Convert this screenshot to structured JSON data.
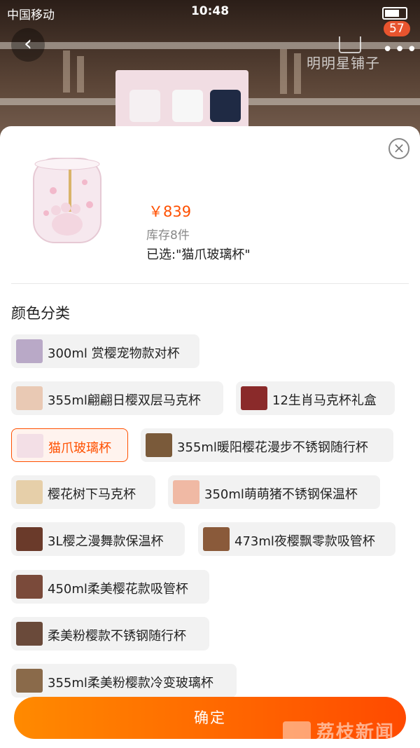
{
  "status_bar": {
    "carrier": "中国移动",
    "time": "10:48"
  },
  "header": {
    "shop_name": "明明星铺子",
    "cart_badge": "57"
  },
  "product": {
    "price": "￥839",
    "stock": "库存8件",
    "selected": "已选:\"猫爪玻璃杯\""
  },
  "section_title": "颜色分类",
  "options": [
    {
      "label": "300ml 赏樱宠物款对杯",
      "thumb_color": "#b9a9c7"
    },
    {
      "label": "355ml翩翩日樱双层马克杯",
      "thumb_color": "#e9c9b4"
    },
    {
      "label": "12生肖马克杯礼盒",
      "thumb_color": "#8a2a2a"
    },
    {
      "label": "猫爪玻璃杯",
      "thumb_color": "#f3dfe6",
      "active": true
    },
    {
      "label": "355ml暖阳樱花漫步不锈钢随行杯",
      "thumb_color": "#7a5a3a"
    },
    {
      "label": "樱花树下马克杯",
      "thumb_color": "#e6cfa9"
    },
    {
      "label": "350ml萌萌猪不锈钢保温杯",
      "thumb_color": "#f0b9a4"
    },
    {
      "label": "3L樱之漫舞款保温杯",
      "thumb_color": "#6a3a2a"
    },
    {
      "label": "473ml夜樱飘零款吸管杯",
      "thumb_color": "#8a5a3a"
    },
    {
      "label": "450ml柔美樱花款吸管杯",
      "thumb_color": "#7a4a3a"
    },
    {
      "label": "柔美粉樱款不锈钢随行杯",
      "thumb_color": "#6a4a3a"
    },
    {
      "label": "355ml柔美粉樱款冷变玻璃杯",
      "thumb_color": "#8a6a4a"
    }
  ],
  "confirm_label": "确定",
  "watermark": "荔枝新闻"
}
